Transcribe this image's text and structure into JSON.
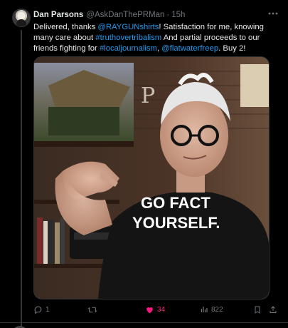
{
  "post": {
    "author_name": "Dan Parsons",
    "author_handle": "@AskDanThePRMan",
    "separator": "·",
    "timestamp": "15h",
    "text_parts": [
      {
        "text": "Delivered, thanks ",
        "link": false
      },
      {
        "text": "@RAYGUNshirts",
        "link": true
      },
      {
        "text": "! Satisfaction for me, knowing many care about ",
        "link": false
      },
      {
        "text": "#truthovertribalism",
        "link": true
      },
      {
        "text": " And partial proceeds to our friends fighting for ",
        "link": false
      },
      {
        "text": "#localjournalism",
        "link": true
      },
      {
        "text": ", ",
        "link": false
      },
      {
        "text": "@flatwaterfreep",
        "link": true
      },
      {
        "text": ". Buy 2!",
        "link": false
      }
    ],
    "shirt_text_line1": "GO FACT",
    "shirt_text_line2": "YOURSELF."
  },
  "actions": {
    "reply_count": "1",
    "retweet_count": "",
    "like_count": "34",
    "view_count": "822"
  },
  "colors": {
    "background": "#000000",
    "text": "#e7e9ea",
    "muted": "#71767b",
    "link": "#1d9bf0",
    "like": "#f91880"
  }
}
